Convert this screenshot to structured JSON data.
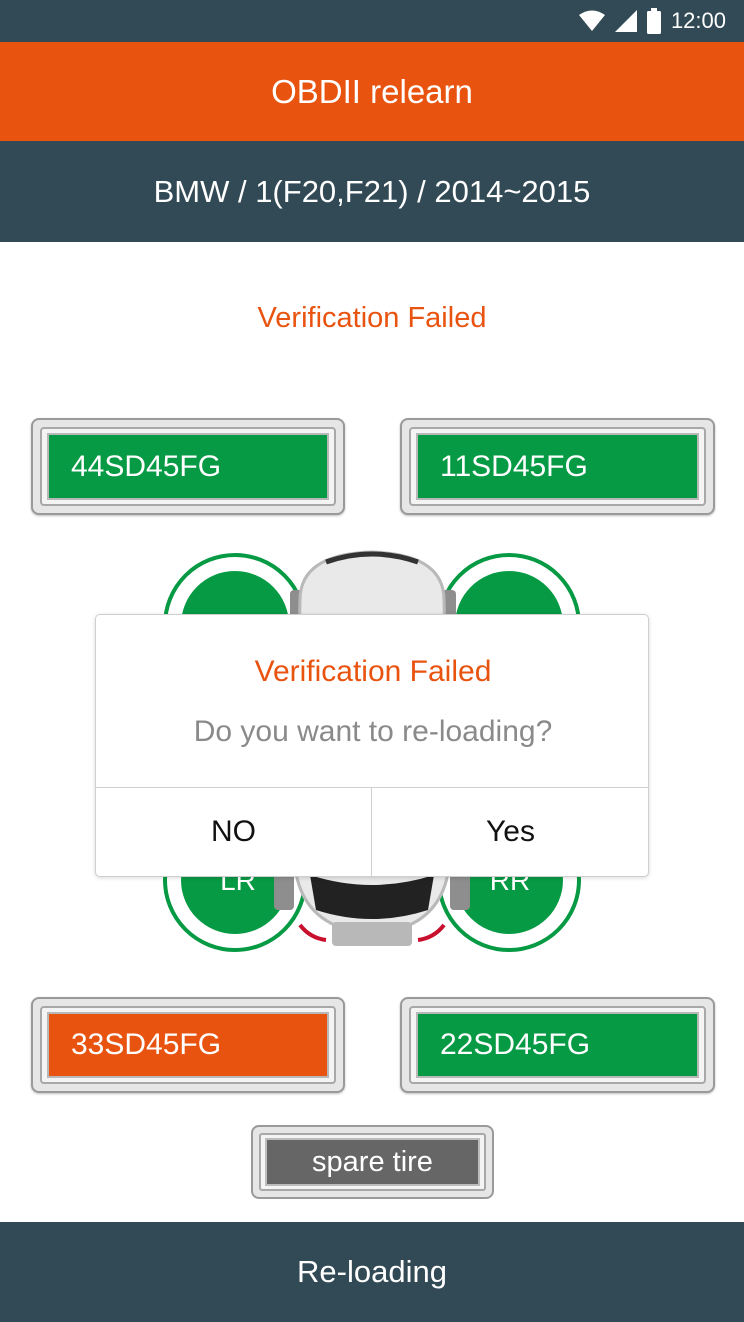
{
  "status_bar": {
    "time": "12:00",
    "icons": [
      "wifi-icon",
      "cell-signal-icon",
      "battery-icon"
    ]
  },
  "app_bar": {
    "title": "OBDII relearn"
  },
  "vehicle": {
    "label": "BMW / 1(F20,F21) / 2014~2015"
  },
  "status": {
    "text": "Verification Failed"
  },
  "sensors": {
    "lf": {
      "id": "44SD45FG",
      "status": "ok"
    },
    "rf": {
      "id": "11SD45FG",
      "status": "ok"
    },
    "lr": {
      "id": "33SD45FG",
      "status": "failed"
    },
    "rr": {
      "id": "22SD45FG",
      "status": "ok"
    },
    "spare": {
      "label": "spare tire"
    }
  },
  "car": {
    "wheel_labels": {
      "lr": "LR",
      "rr": "RR"
    }
  },
  "dialog": {
    "title": "Verification Failed",
    "message": "Do you want to re-loading?",
    "no_label": "NO",
    "yes_label": "Yes"
  },
  "footer": {
    "button_label": "Re-loading"
  },
  "colors": {
    "accent": "#e95310",
    "dark": "#324a55",
    "ok_green": "#079a44",
    "spare_gray": "#666666"
  }
}
